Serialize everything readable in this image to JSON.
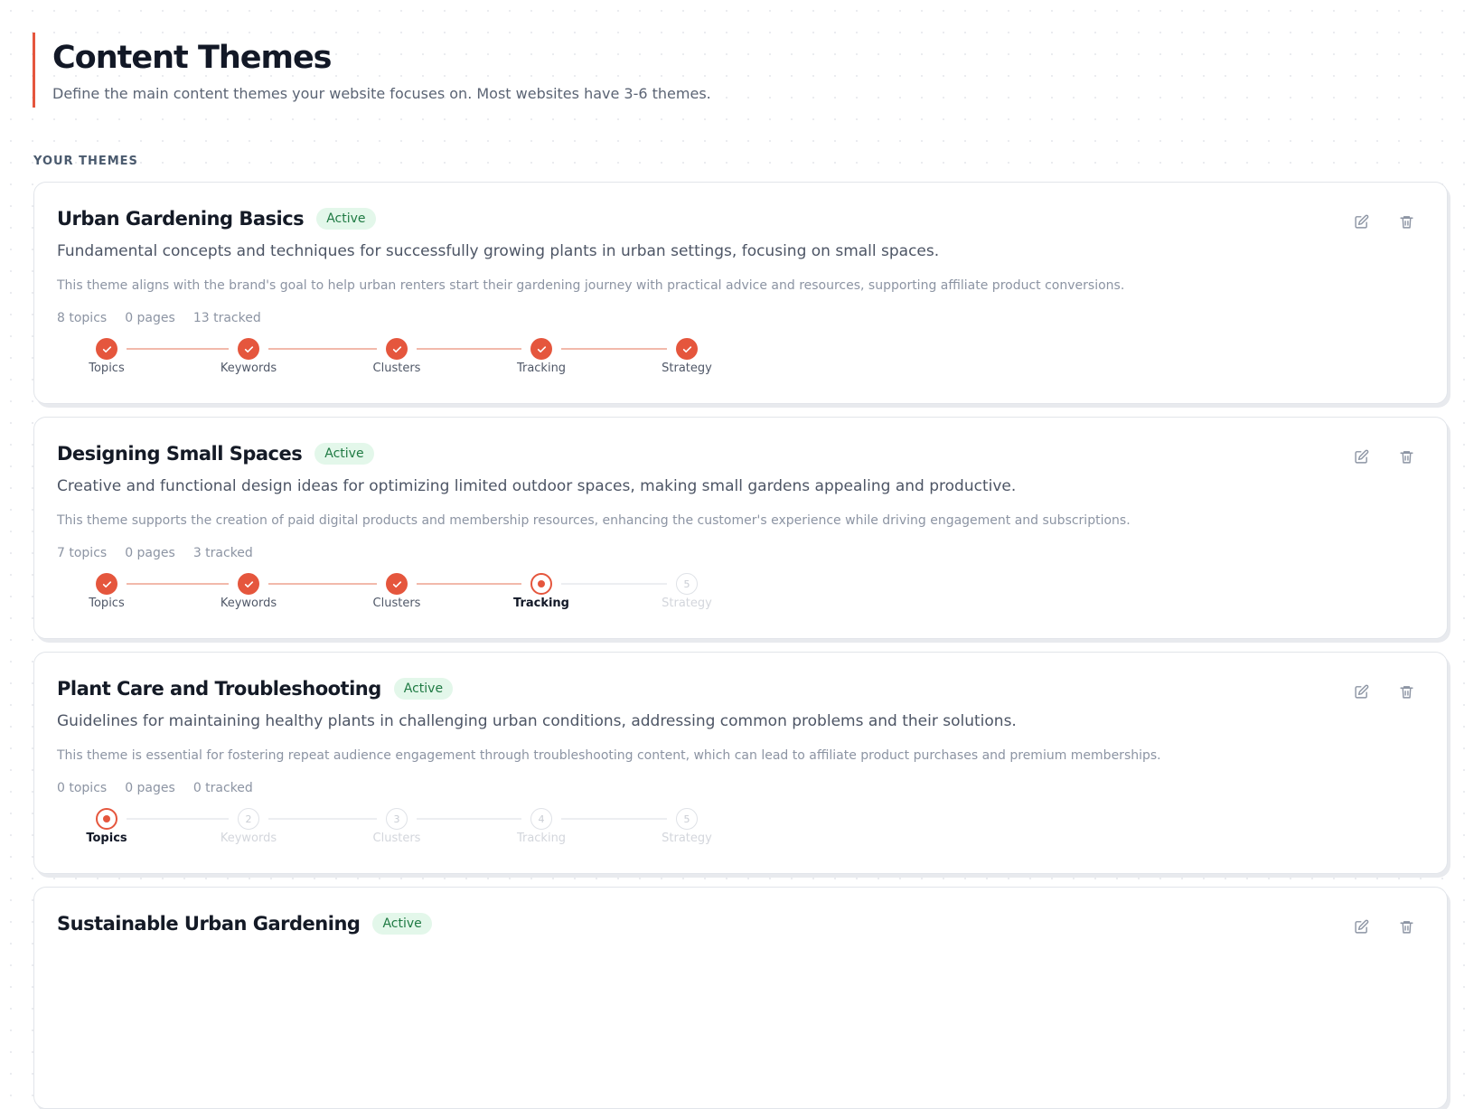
{
  "page": {
    "title": "Content Themes",
    "subtitle": "Define the main content themes your website focuses on. Most websites have 3-6 themes.",
    "section_label": "YOUR THEMES"
  },
  "step_names": [
    "Topics",
    "Keywords",
    "Clusters",
    "Tracking",
    "Strategy"
  ],
  "themes": [
    {
      "title": "Urban Gardening Basics",
      "status": "Active",
      "description": "Fundamental concepts and techniques for successfully growing plants in urban settings, focusing on small spaces.",
      "note": "This theme aligns with the brand's goal to help urban renters start their gardening journey with practical advice and resources, supporting affiliate product conversions.",
      "stats": {
        "topics": "8 topics",
        "pages": "0 pages",
        "tracked": "13 tracked"
      },
      "completed_steps": 5,
      "current_step": null
    },
    {
      "title": "Designing Small Spaces",
      "status": "Active",
      "description": "Creative and functional design ideas for optimizing limited outdoor spaces, making small gardens appealing and productive.",
      "note": "This theme supports the creation of paid digital products and membership resources, enhancing the customer's experience while driving engagement and subscriptions.",
      "stats": {
        "topics": "7 topics",
        "pages": "0 pages",
        "tracked": "3 tracked"
      },
      "completed_steps": 3,
      "current_step": 4
    },
    {
      "title": "Plant Care and Troubleshooting",
      "status": "Active",
      "description": "Guidelines for maintaining healthy plants in challenging urban conditions, addressing common problems and their solutions.",
      "note": "This theme is essential for fostering repeat audience engagement through troubleshooting content, which can lead to affiliate product purchases and premium memberships.",
      "stats": {
        "topics": "0 topics",
        "pages": "0 pages",
        "tracked": "0 tracked"
      },
      "completed_steps": 0,
      "current_step": 1
    },
    {
      "title": "Sustainable Urban Gardening",
      "status": "Active"
    }
  ],
  "colors": {
    "accent": "#e5563d",
    "badge_bg": "#e3f7ea",
    "badge_text": "#1f7a43"
  },
  "icons": {
    "edit": "edit-icon",
    "delete": "trash-icon",
    "check": "check-icon"
  }
}
